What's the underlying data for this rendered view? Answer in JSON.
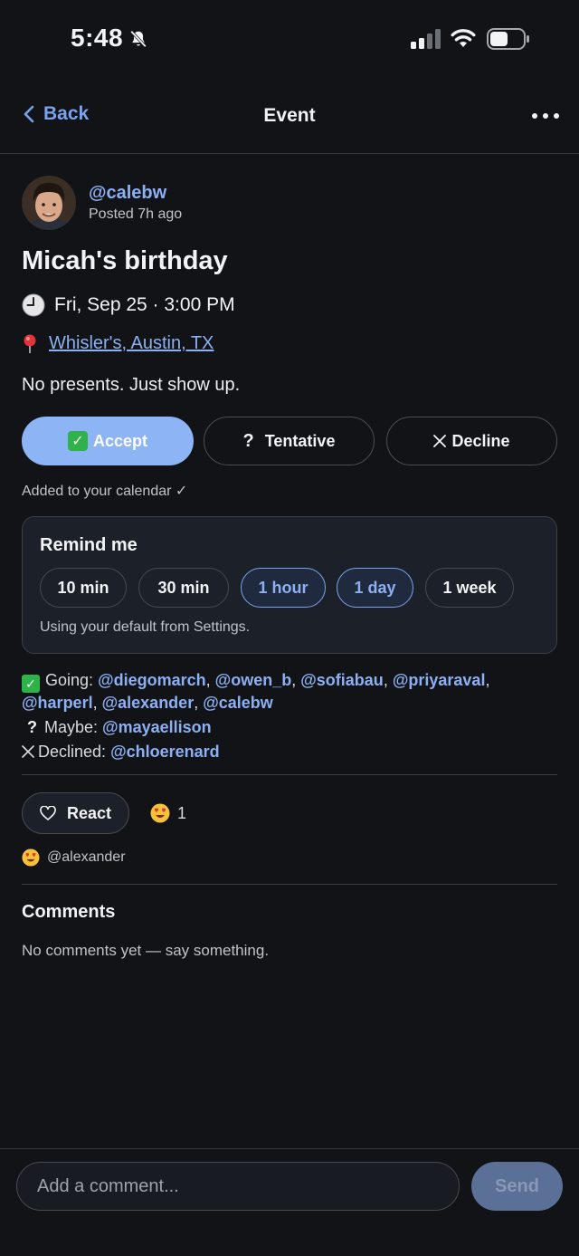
{
  "status": {
    "time": "5:48"
  },
  "nav": {
    "back_label": "Back",
    "title": "Event"
  },
  "post": {
    "author": "@calebw",
    "posted": "Posted 7h ago"
  },
  "event": {
    "title": "Micah's birthday",
    "datetime": "Fri, Sep 25 · 3:00 PM",
    "location": "Whisler's, Austin, TX",
    "description": "No presents. Just show up."
  },
  "rsvp": {
    "accept": "Accept",
    "tentative": "Tentative",
    "decline": "Decline",
    "selected": "accept",
    "accent": "#8db4f5"
  },
  "added_note": "Added to your calendar ✓",
  "remind": {
    "title": "Remind me",
    "options": [
      {
        "label": "10 min",
        "selected": false
      },
      {
        "label": "30 min",
        "selected": false
      },
      {
        "label": "1 hour",
        "selected": true
      },
      {
        "label": "1 day",
        "selected": true
      },
      {
        "label": "1 week",
        "selected": false
      }
    ],
    "note": "Using your default from Settings."
  },
  "attendees": {
    "going_label": "Going:",
    "going": [
      "@diegomarch",
      "@owen_b",
      "@sofiabau",
      "@priyaraval",
      "@harperl",
      "@alexander",
      "@calebw"
    ],
    "maybe_label": "Maybe:",
    "maybe": [
      "@mayaellison"
    ],
    "declined_label": "Declined:",
    "declined": [
      "@chloerenard"
    ]
  },
  "reactions": {
    "react_label": "React",
    "count": "1",
    "reactor": "@alexander"
  },
  "comments": {
    "title": "Comments",
    "empty": "No comments yet — say something."
  },
  "composer": {
    "placeholder": "Add a comment...",
    "send_label": "Send"
  }
}
